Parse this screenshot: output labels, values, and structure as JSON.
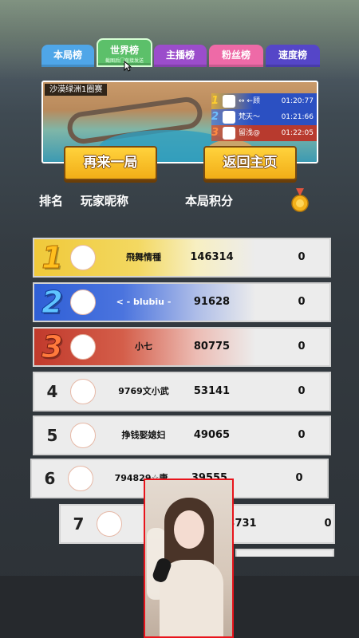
{
  "tabs": [
    {
      "label": "本局榜"
    },
    {
      "label": "世界榜",
      "sub": "截图后门直接发送"
    },
    {
      "label": "主播榜"
    },
    {
      "label": "粉丝榜"
    },
    {
      "label": "速度榜"
    }
  ],
  "race": {
    "title": "沙漠绿洲1圈赛",
    "results": [
      {
        "place": "1",
        "name": "↔ ←顾",
        "time": "01:20:77"
      },
      {
        "place": "2",
        "name": "梵天～",
        "time": "01:21:66"
      },
      {
        "place": "3",
        "name": "留浅@",
        "time": "01:22:05"
      }
    ]
  },
  "buttons": {
    "again": "再来一局",
    "home": "返回主页"
  },
  "headers": {
    "rank": "排名",
    "nickname": "玩家昵称",
    "score": "本局积分"
  },
  "rows": [
    {
      "rank": "1",
      "name": "飛舞情種",
      "score": "146314",
      "medals": "0"
    },
    {
      "rank": "2",
      "name": "< - blubiu -",
      "score": "91628",
      "medals": "0"
    },
    {
      "rank": "3",
      "name": "小七",
      "score": "80775",
      "medals": "0"
    },
    {
      "rank": "4",
      "name": "9769文小武",
      "score": "53141",
      "medals": "0"
    },
    {
      "rank": "5",
      "name": "挣钱娶媳妇",
      "score": "49065",
      "medals": "0"
    },
    {
      "rank": "6",
      "name": "794829☆康",
      "score": "39555",
      "medals": "0"
    },
    {
      "rank": "7",
      "name": "",
      "score": "3731",
      "medals": "0"
    }
  ],
  "colors": {
    "gold": "#f0c93a",
    "blue": "#2f5fd6",
    "red": "#c13a2c",
    "cam_border": "#e8141c"
  }
}
